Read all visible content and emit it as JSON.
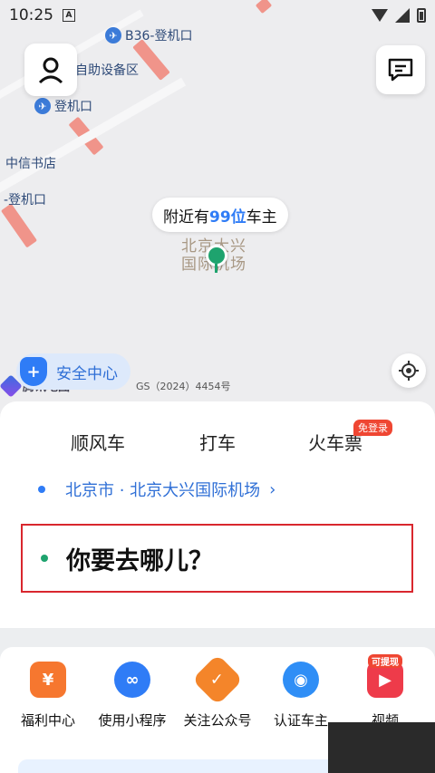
{
  "status_bar": {
    "time": "10:25",
    "a_label": "A"
  },
  "map": {
    "pois": [
      {
        "label": "B36-登机口",
        "has_plane": true
      },
      {
        "label": "自助设备区",
        "has_plane": false
      },
      {
        "label": "登机口",
        "has_plane": true
      },
      {
        "label": "中信书店",
        "has_plane": false
      },
      {
        "label": "-登机口",
        "has_plane": false
      }
    ],
    "airport_label_line1": "北京大兴",
    "airport_label_line2": "国际机场",
    "nearby_prefix": "附近有",
    "nearby_count": "99位",
    "nearby_suffix": "车主",
    "safety_label": "安全中心",
    "safety_icon_text": "+",
    "tencent_label": "腾讯地图",
    "copyright": "GS（2024）4454号"
  },
  "sheet": {
    "tabs": [
      "顺风车",
      "打车",
      "火车票"
    ],
    "train_badge": "免登录",
    "from_location": "北京市 · 北京大兴国际机场",
    "from_chevron": "›",
    "destination_placeholder": "你要去哪儿？"
  },
  "services": [
    {
      "label": "福利中心",
      "icon": "coupon-icon",
      "glyph": "¥",
      "color": "#f6772f",
      "tag": ""
    },
    {
      "label": "使用小程序",
      "icon": "mini-program-icon",
      "glyph": "∞",
      "color": "#2f7cf6",
      "tag": ""
    },
    {
      "label": "关注公众号",
      "icon": "badge-check-icon",
      "glyph": "✓",
      "color": "#f4852a",
      "tag": ""
    },
    {
      "label": "认证车主",
      "icon": "driver-icon",
      "glyph": "◉",
      "color": "#2f8ef6",
      "tag": ""
    },
    {
      "label": "视频",
      "icon": "video-icon",
      "glyph": "▶",
      "color": "#ee3b4a",
      "tag": "可提现"
    }
  ],
  "colors": {
    "accent": "#2f7cf6",
    "alert": "#ef4632",
    "pin": "#1ea36e"
  }
}
